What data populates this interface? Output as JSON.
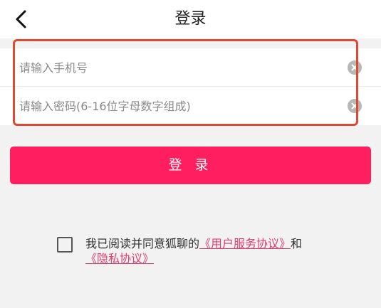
{
  "header": {
    "title": "登录",
    "back_icon": "chevron-left-icon"
  },
  "form": {
    "phone_placeholder": "请输入手机号",
    "password_placeholder": "请输入密码(6-16位字母数字组成)",
    "clear_icon": "clear-circle-icon"
  },
  "login_button": "登  录",
  "agreement": {
    "prefix": "我已阅读并同意狐聊的",
    "user_agreement": "《用户服务协议》",
    "conjunction": "和",
    "privacy_policy": "《隐私协议》",
    "checked": false
  },
  "colors": {
    "accent": "#ff1e5f",
    "link": "#e0406f",
    "highlight_border": "#dc4a33",
    "background": "#f2f2f2"
  }
}
